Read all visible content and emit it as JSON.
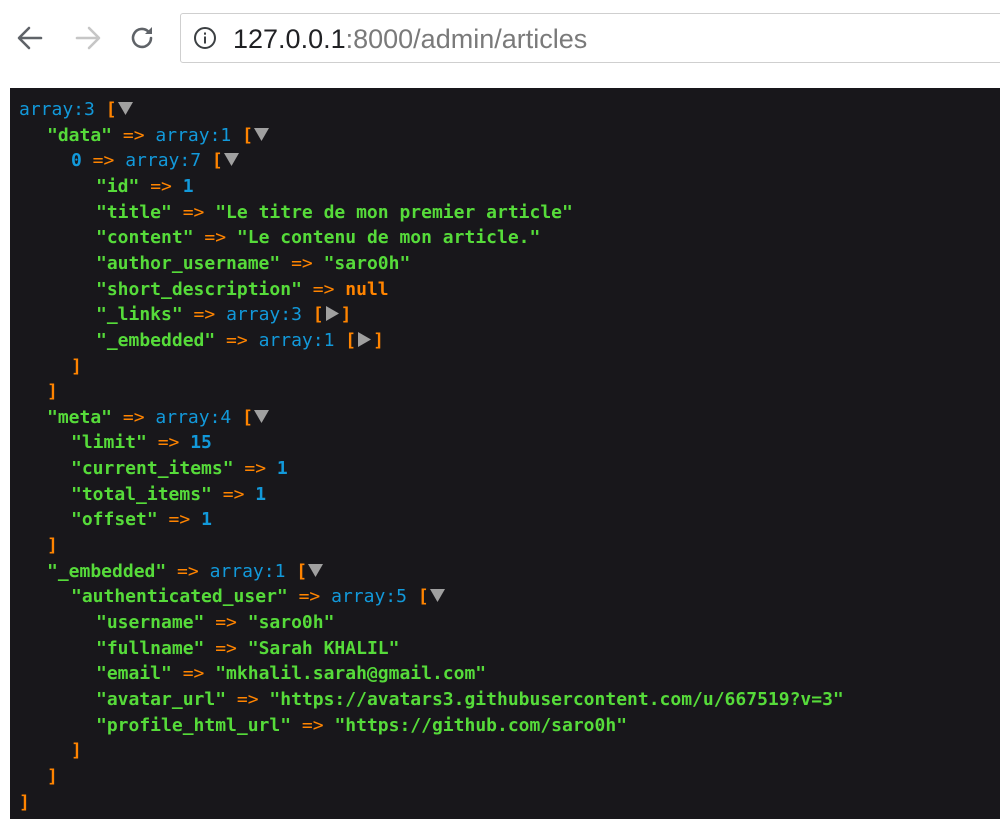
{
  "browser": {
    "url_host": "127.0.0.1",
    "url_path": ":8000/admin/articles"
  },
  "dump": {
    "lines": [
      {
        "indent": 0,
        "parts": [
          [
            "t",
            "array:3"
          ],
          [
            "sp",
            " "
          ],
          [
            "br",
            "["
          ],
          [
            "tog",
            "open"
          ]
        ]
      },
      {
        "indent": 1,
        "parts": [
          [
            "k",
            "\"data\""
          ],
          [
            "op",
            " => "
          ],
          [
            "t",
            "array:1"
          ],
          [
            "sp",
            " "
          ],
          [
            "br",
            "["
          ],
          [
            "tog",
            "open"
          ]
        ]
      },
      {
        "indent": 2,
        "parts": [
          [
            "n",
            "0"
          ],
          [
            "op",
            " => "
          ],
          [
            "t",
            "array:7"
          ],
          [
            "sp",
            " "
          ],
          [
            "br",
            "["
          ],
          [
            "tog",
            "open"
          ]
        ]
      },
      {
        "indent": 3,
        "parts": [
          [
            "k",
            "\"id\""
          ],
          [
            "op",
            " => "
          ],
          [
            "n",
            "1"
          ]
        ]
      },
      {
        "indent": 3,
        "parts": [
          [
            "k",
            "\"title\""
          ],
          [
            "op",
            " => "
          ],
          [
            "s",
            "\"Le titre de mon premier article\""
          ]
        ]
      },
      {
        "indent": 3,
        "parts": [
          [
            "k",
            "\"content\""
          ],
          [
            "op",
            " => "
          ],
          [
            "s",
            "\"Le contenu de mon article.\""
          ]
        ]
      },
      {
        "indent": 3,
        "parts": [
          [
            "k",
            "\"author_username\""
          ],
          [
            "op",
            " => "
          ],
          [
            "s",
            "\"saro0h\""
          ]
        ]
      },
      {
        "indent": 3,
        "parts": [
          [
            "k",
            "\"short_description\""
          ],
          [
            "op",
            " => "
          ],
          [
            "cst",
            "null"
          ]
        ]
      },
      {
        "indent": 3,
        "parts": [
          [
            "k",
            "\"_links\""
          ],
          [
            "op",
            " => "
          ],
          [
            "t",
            "array:3"
          ],
          [
            "sp",
            " "
          ],
          [
            "br",
            "["
          ],
          [
            "tog",
            "closed"
          ],
          [
            "br",
            "]"
          ]
        ]
      },
      {
        "indent": 3,
        "parts": [
          [
            "k",
            "\"_embedded\""
          ],
          [
            "op",
            " => "
          ],
          [
            "t",
            "array:1"
          ],
          [
            "sp",
            " "
          ],
          [
            "br",
            "["
          ],
          [
            "tog",
            "closed"
          ],
          [
            "br",
            "]"
          ]
        ]
      },
      {
        "indent": 2,
        "parts": [
          [
            "br",
            "]"
          ]
        ]
      },
      {
        "indent": 1,
        "parts": [
          [
            "br",
            "]"
          ]
        ]
      },
      {
        "indent": 1,
        "parts": [
          [
            "k",
            "\"meta\""
          ],
          [
            "op",
            " => "
          ],
          [
            "t",
            "array:4"
          ],
          [
            "sp",
            " "
          ],
          [
            "br",
            "["
          ],
          [
            "tog",
            "open"
          ]
        ]
      },
      {
        "indent": 2,
        "parts": [
          [
            "k",
            "\"limit\""
          ],
          [
            "op",
            " => "
          ],
          [
            "n",
            "15"
          ]
        ]
      },
      {
        "indent": 2,
        "parts": [
          [
            "k",
            "\"current_items\""
          ],
          [
            "op",
            " => "
          ],
          [
            "n",
            "1"
          ]
        ]
      },
      {
        "indent": 2,
        "parts": [
          [
            "k",
            "\"total_items\""
          ],
          [
            "op",
            " => "
          ],
          [
            "n",
            "1"
          ]
        ]
      },
      {
        "indent": 2,
        "parts": [
          [
            "k",
            "\"offset\""
          ],
          [
            "op",
            " => "
          ],
          [
            "n",
            "1"
          ]
        ]
      },
      {
        "indent": 1,
        "parts": [
          [
            "br",
            "]"
          ]
        ]
      },
      {
        "indent": 1,
        "parts": [
          [
            "k",
            "\"_embedded\""
          ],
          [
            "op",
            " => "
          ],
          [
            "t",
            "array:1"
          ],
          [
            "sp",
            " "
          ],
          [
            "br",
            "["
          ],
          [
            "tog",
            "open"
          ]
        ]
      },
      {
        "indent": 2,
        "parts": [
          [
            "k",
            "\"authenticated_user\""
          ],
          [
            "op",
            " => "
          ],
          [
            "t",
            "array:5"
          ],
          [
            "sp",
            " "
          ],
          [
            "br",
            "["
          ],
          [
            "tog",
            "open"
          ]
        ]
      },
      {
        "indent": 3,
        "parts": [
          [
            "k",
            "\"username\""
          ],
          [
            "op",
            " => "
          ],
          [
            "s",
            "\"saro0h\""
          ]
        ]
      },
      {
        "indent": 3,
        "parts": [
          [
            "k",
            "\"fullname\""
          ],
          [
            "op",
            " => "
          ],
          [
            "s",
            "\"Sarah KHALIL\""
          ]
        ]
      },
      {
        "indent": 3,
        "parts": [
          [
            "k",
            "\"email\""
          ],
          [
            "op",
            " => "
          ],
          [
            "s",
            "\"mkhalil.sarah@gmail.com\""
          ]
        ]
      },
      {
        "indent": 3,
        "parts": [
          [
            "k",
            "\"avatar_url\""
          ],
          [
            "op",
            " => "
          ],
          [
            "s",
            "\"https://avatars3.githubusercontent.com/u/667519?v=3\""
          ]
        ]
      },
      {
        "indent": 3,
        "parts": [
          [
            "k",
            "\"profile_html_url\""
          ],
          [
            "op",
            " => "
          ],
          [
            "s",
            "\"https://github.com/saro0h\""
          ]
        ]
      },
      {
        "indent": 2,
        "parts": [
          [
            "br",
            "]"
          ]
        ]
      },
      {
        "indent": 1,
        "parts": [
          [
            "br",
            "]"
          ]
        ]
      },
      {
        "indent": 0,
        "parts": [
          [
            "br",
            "]"
          ]
        ]
      }
    ]
  }
}
